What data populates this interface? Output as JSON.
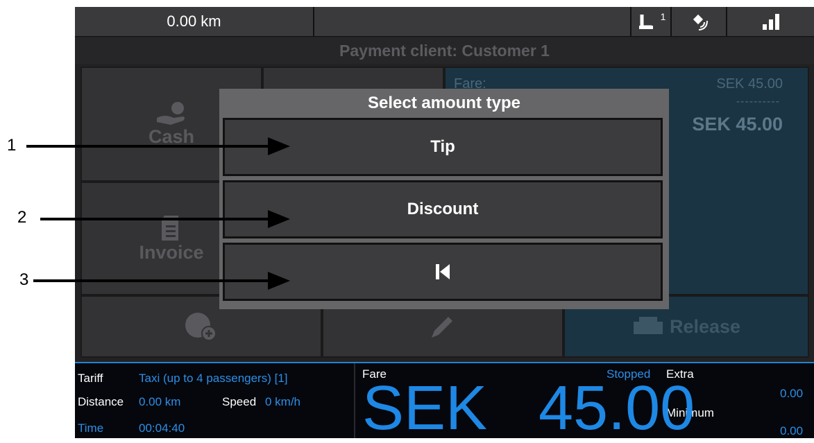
{
  "status_bar": {
    "distance": "0.00 km",
    "icons": [
      "seat-occupied-icon",
      "satellite-icon",
      "signal-strength-icon"
    ],
    "seat_badge": "1"
  },
  "payment_title": "Payment client: Customer 1",
  "tiles": {
    "cash": "Cash",
    "invoice": "Invoice",
    "release": "Release"
  },
  "fare_panel": {
    "label": "Fare:",
    "value": "SEK 45.00",
    "separator": "----------",
    "total": "SEK 45.00"
  },
  "dialog": {
    "title": "Select amount type",
    "options": [
      "Tip",
      "Discount"
    ],
    "back_icon": "skip-back-icon"
  },
  "info": {
    "tariff_label": "Tariff",
    "tariff_value": "Taxi (up to 4 passengers) [1]",
    "distance_label": "Distance",
    "distance_value": "0.00 km",
    "speed_label": "Speed",
    "speed_value": "0 km/h",
    "time_label": "Time",
    "time_value": "00:04:40",
    "fare_label": "Fare",
    "status": "Stopped",
    "currency": "SEK",
    "amount": "45.00",
    "extra_label": "Extra",
    "extra_value": "0.00",
    "minimum_label": "Minimum",
    "minimum_value": "0.00"
  },
  "annotations": [
    "1",
    "2",
    "3"
  ],
  "colors": {
    "accent_blue": "#1e88e5",
    "dialog_bg": "#666668",
    "fare_panel": "#1a3444"
  }
}
